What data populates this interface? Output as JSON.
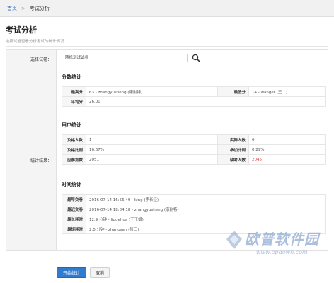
{
  "breadcrumb": {
    "home": "首页",
    "separator": ">",
    "current": "考试分析"
  },
  "page": {
    "title": "考试分析",
    "subtitle": "选择试卷查看分析考试的统计情况"
  },
  "form": {
    "select_label": "选择试卷：",
    "select_value": "随机测试试卷",
    "result_label": "统计结果："
  },
  "score_stats": {
    "title": "分数统计",
    "max_label": "最高分",
    "max_value": "63  -  zhangyusheng (康耐特)",
    "min_label": "最低分",
    "min_value": "14  -  wanger (王二)",
    "avg_label": "平均分",
    "avg_value": "26.00"
  },
  "user_stats": {
    "title": "用户统计",
    "pass_count_label": "及格人数",
    "pass_count_value": "1",
    "actual_label": "实际人数",
    "actual_value": "6",
    "pass_rate_label": "及格比例",
    "pass_rate_value": "16.67%",
    "join_rate_label": "参加比例",
    "join_rate_value": "0.29%",
    "expected_label": "应参加数",
    "expected_value": "2051",
    "absent_label": "缺考人数",
    "absent_value": "2045"
  },
  "time_stats": {
    "title": "时间统计",
    "earliest_label": "最早交卷",
    "earliest_value": "2016-07-14 16:56:49  -  king (李长征)",
    "latest_label": "最迟交卷",
    "latest_value": "2016-07-14 18:04:18  -  zhangyusheng (康耐特)",
    "longest_label": "最长耗时",
    "longest_value": "12.9 分钟  -  liudehua (王玉娟)",
    "shortest_label": "最短耗时",
    "shortest_value": "2.0 分钟  -  zhangsan (张三)"
  },
  "buttons": {
    "start": "开始统计",
    "cancel": "取消"
  },
  "watermark": {
    "text": "欧普软件园",
    "url": "www.opdown.com"
  },
  "colors": {
    "primary": "#2f7bd0",
    "link": "#2c6fbd",
    "alert": "#e03c3c"
  }
}
